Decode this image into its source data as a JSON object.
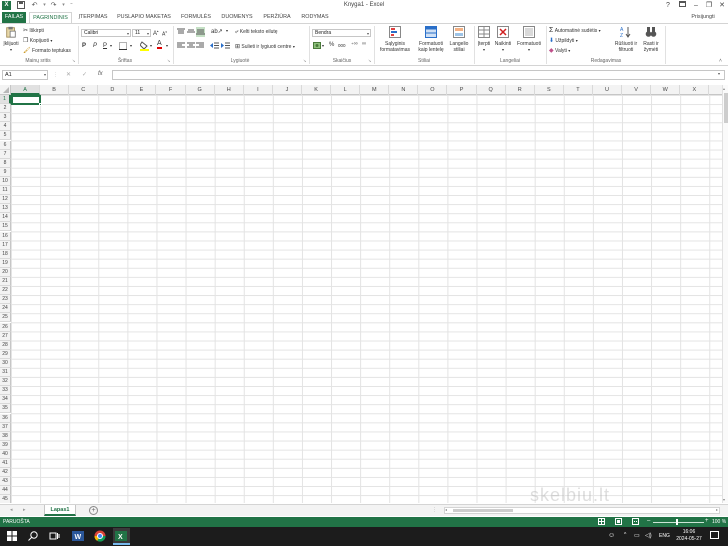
{
  "window": {
    "title": "Knyga1 - Excel",
    "help": "?",
    "account": "Prisijungti",
    "qat": {
      "save_icon": "save-icon",
      "undo_icon": "undo-icon",
      "redo_icon": "redo-icon"
    }
  },
  "tabs": [
    {
      "label": "FAILAS"
    },
    {
      "label": "PAGRINDINIS"
    },
    {
      "label": "ĮTERPIMAS"
    },
    {
      "label": "PUSLAPIO MAKETAS"
    },
    {
      "label": "FORMULĖS"
    },
    {
      "label": "DUOMENYS"
    },
    {
      "label": "PERŽIŪRA"
    },
    {
      "label": "RODYMAS"
    }
  ],
  "ribbon": {
    "clipboard": {
      "paste": "Įklijuoti",
      "cut": "Iškirpti",
      "copy": "Kopijuoti",
      "format_painter": "Formato teptukas",
      "group_label": "Mainų sritis"
    },
    "font": {
      "font_name": "Calibri",
      "font_size": "11",
      "bold": "P",
      "italic": "P",
      "underline": "P",
      "group_label": "Šriftas"
    },
    "alignment": {
      "wrap_text": "Kelti teksto eilutę",
      "merge_center": "Sulieti ir lygiuoti centre",
      "group_label": "Lygiuotė"
    },
    "number": {
      "format": "Bendra",
      "percent": "%",
      "comma": "000",
      "group_label": "Skaičius"
    },
    "styles": {
      "conditional_l1": "Sąlyginis",
      "conditional_l2": "formatavimas",
      "format_table_l1": "Formatuoti",
      "format_table_l2": "kaip lentelę",
      "cell_styles_l1": "Langelio",
      "cell_styles_l2": "stiliai",
      "group_label": "Stiliai"
    },
    "cells": {
      "insert": "Įterpti",
      "delete": "Naikinti",
      "format": "Formatuoti",
      "group_label": "Langeliai"
    },
    "editing": {
      "autosum": "Automatinė sudėtis",
      "fill": "Užpildyti",
      "clear": "Valyti",
      "sort_l1": "Rūšiuoti ir",
      "sort_l2": "filtruoti",
      "find_l1": "Rasti ir",
      "find_l2": "žymėti",
      "group_label": "Redagavimas"
    }
  },
  "formula_bar": {
    "name_box": "A1",
    "fx": "fx",
    "value": ""
  },
  "grid": {
    "columns": [
      "A",
      "B",
      "C",
      "D",
      "E",
      "F",
      "G",
      "H",
      "I",
      "J",
      "K",
      "L",
      "M",
      "N",
      "O",
      "P",
      "Q",
      "R",
      "S",
      "T",
      "U",
      "V",
      "W",
      "X"
    ],
    "rows": [
      "1",
      "2",
      "3",
      "4",
      "5",
      "6",
      "7",
      "8",
      "9",
      "10",
      "11",
      "12",
      "13",
      "14",
      "15",
      "16",
      "17",
      "18",
      "19",
      "20",
      "21",
      "22",
      "23",
      "24",
      "25",
      "26",
      "27",
      "28",
      "29",
      "30",
      "31",
      "32",
      "33",
      "34",
      "35",
      "36",
      "37",
      "38",
      "39",
      "40",
      "41",
      "42",
      "43",
      "44",
      "45"
    ],
    "selected_cell": "A1"
  },
  "sheets": {
    "tabs": [
      {
        "label": "Lapas1"
      }
    ],
    "add_icon": "plus-icon"
  },
  "status": {
    "mode": "PARUOŠTA",
    "zoom": "100 %"
  },
  "taskbar": {
    "language": "ENG",
    "time": "16:06",
    "date": "2024-05-27"
  },
  "watermark": "skelbiu.lt",
  "colors": {
    "excel_green": "#217346",
    "taskbar": "#1c1c1c"
  }
}
